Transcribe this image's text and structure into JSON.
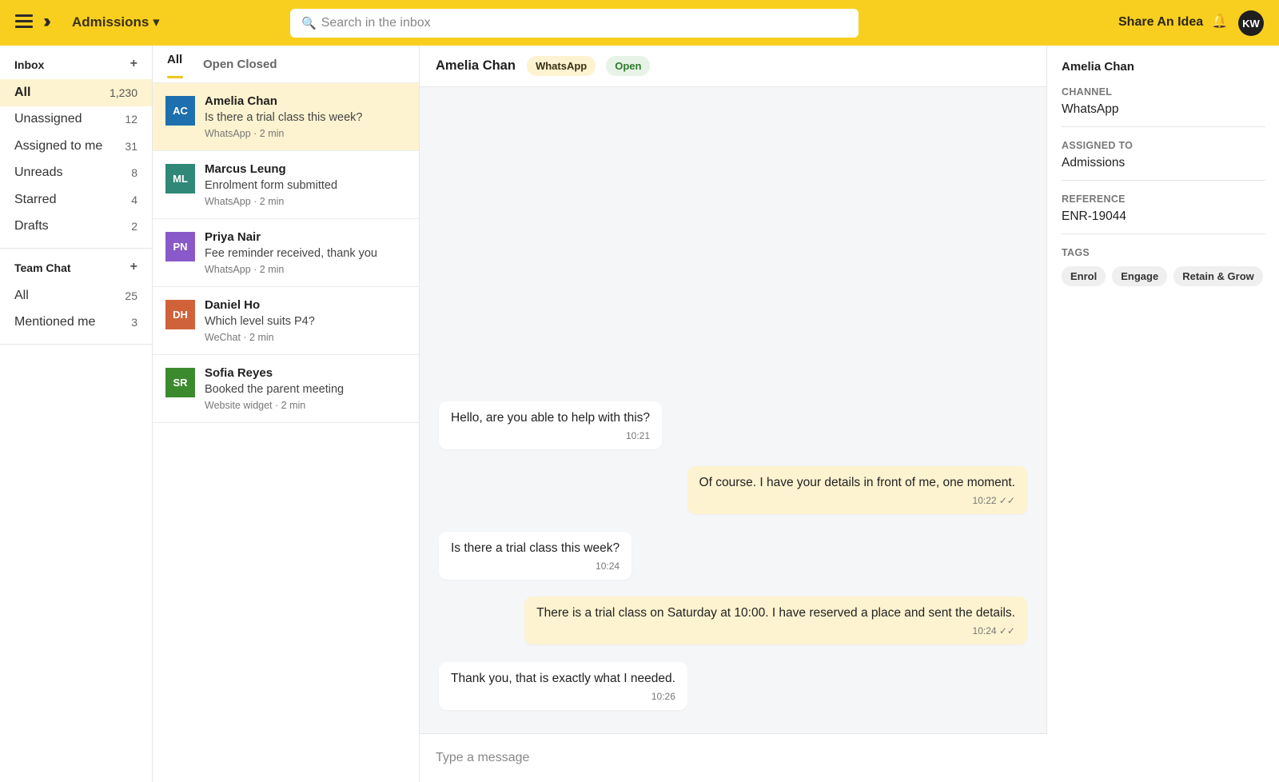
{
  "topbar": {
    "workspace": "Admissions ▾",
    "search_placeholder": "Search in the inbox",
    "share_label": "Share An Idea",
    "user_initials": "KW"
  },
  "sidebar": {
    "inbox_title": "Inbox",
    "inbox_items": [
      {
        "label": "All",
        "count": "1,230"
      },
      {
        "label": "Unassigned",
        "count": "12"
      },
      {
        "label": "Assigned to me",
        "count": "31"
      },
      {
        "label": "Unreads",
        "count": "8"
      },
      {
        "label": "Starred",
        "count": "4"
      },
      {
        "label": "Drafts",
        "count": "2"
      }
    ],
    "team_title": "Team Chat",
    "team_items": [
      {
        "label": "All",
        "count": "25"
      },
      {
        "label": "Mentioned me",
        "count": "3"
      }
    ],
    "plus": "+"
  },
  "list": {
    "tabs": [
      "All",
      "Open Closed"
    ],
    "conversations": [
      {
        "initials": "AC",
        "name": "Amelia Chan",
        "preview": "Is there a trial class this week?",
        "meta": "WhatsApp · 2 min",
        "color": "#1d6fae"
      },
      {
        "initials": "ML",
        "name": "Marcus Leung",
        "preview": "Enrolment form submitted",
        "meta": "WhatsApp · 2 min",
        "color": "#2f8878"
      },
      {
        "initials": "PN",
        "name": "Priya Nair",
        "preview": "Fee reminder received, thank you",
        "meta": "WhatsApp · 2 min",
        "color": "#8a59c9"
      },
      {
        "initials": "DH",
        "name": "Daniel Ho",
        "preview": "Which level suits P4?",
        "meta": "WeChat · 2 min",
        "color": "#d0623a"
      },
      {
        "initials": "SR",
        "name": "Sofia Reyes",
        "preview": "Booked the parent meeting",
        "meta": "Website widget · 2 min",
        "color": "#3c8a2e"
      }
    ]
  },
  "chat": {
    "name": "Amelia Chan",
    "channel": "WhatsApp",
    "status": "Open",
    "messages": [
      {
        "text": "Hello, are you able to help with this?",
        "time": "10:21"
      },
      {
        "text": "Of course. I have your details in front of me, one moment.",
        "time": "10:22 ✓✓"
      },
      {
        "text": "Is there a trial class this week?",
        "time": "10:24"
      },
      {
        "text": "There is a trial class on Saturday at 10:00. I have reserved a place and sent the details.",
        "time": "10:24 ✓✓"
      },
      {
        "text": "Thank you, that is exactly what I needed.",
        "time": "10:26"
      }
    ],
    "composer_placeholder": "Type a message"
  },
  "details": {
    "name": "Amelia Chan",
    "channel_label": "CHANNEL",
    "channel_value": "WhatsApp",
    "assigned_label": "ASSIGNED TO",
    "assigned_value": "Admissions",
    "reference_label": "REFERENCE",
    "reference_value": "ENR-19044",
    "tags_label": "TAGS",
    "tags": [
      "Enrol",
      "Engage",
      "Retain & Grow"
    ]
  },
  "colors": {
    "accent": "#f8cf1f",
    "highlight": "#fdf3d0"
  }
}
